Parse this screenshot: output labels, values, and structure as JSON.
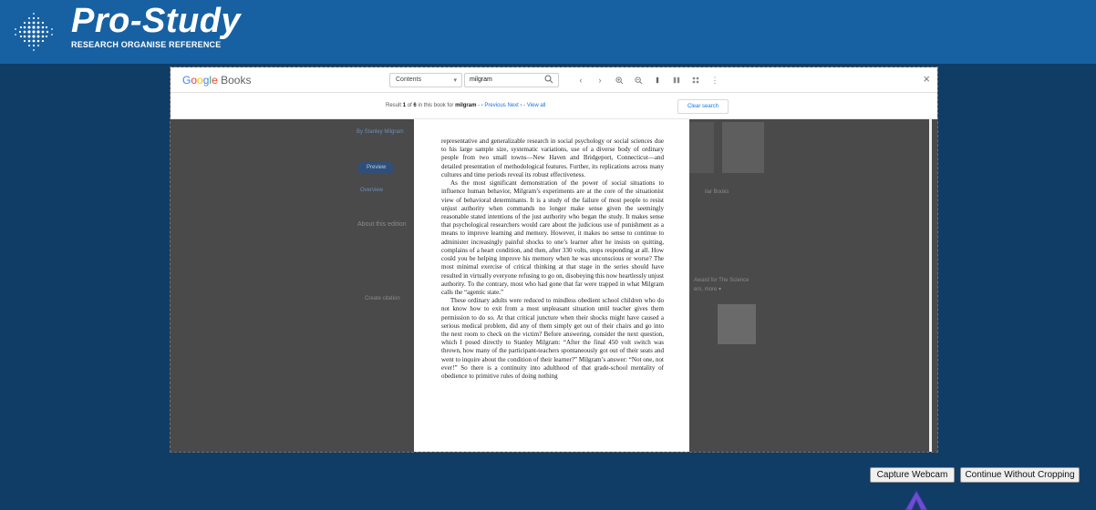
{
  "app": {
    "title": "Pro-Study",
    "subtitle": "RESEARCH ORGANISE REFERENCE"
  },
  "viewer": {
    "brand": {
      "google": [
        "G",
        "o",
        "o",
        "g",
        "l",
        "e"
      ],
      "books": "Books"
    },
    "toolbar": {
      "contents_label": "Contents",
      "search_value": "milgram",
      "close_label": "×"
    },
    "result": {
      "prefix": "Result ",
      "current": "1",
      "of": " of ",
      "total": "6",
      "in_book_for": " in this book for ",
      "term": "milgram",
      "previous": "‹ Previous",
      "next": "Next ›",
      "view_all": "View all",
      "clear_search": "Clear search"
    },
    "page_paragraphs": [
      "representative and generalizable research in social psychology or social sciences due to his large sample size, systematic variations, use of a diverse body of ordinary people from two small towns—New Haven and Bridgeport, Connecticut—and detailed presentation of methodological features. Further, its replications across many cultures and time periods reveal its robust effectiveness.",
      "As the most significant demonstration of the power of social situations to influence human behavior, Milgram’s experiments are at the core of the situationist view of behavioral determinants. It is a study of the failure of most people to resist unjust authority when commands no longer make sense given the seemingly reasonable stated intentions of the just authority who began the study. It makes sense that psychological researchers would care about the judicious use of punishment as a means to improve learning and memory. However, it makes no sense to continue to administer increasingly painful shocks to one’s learner after he insists on quitting, complains of a heart condition, and then, after 330 volts, stops responding at all. How could you be helping improve his memory when he was unconscious or worse? The most minimal exercise of critical thinking at that stage in the series should have resulted in virtually everyone refusing to go on, disobeying this now heartlessly unjust authority. To the contrary, most who had gone that far were trapped in what Milgram calls the “agentic state.”",
      "These ordinary adults were reduced to mindless obedient school children who do not know how to exit from a most unpleasant situation until teacher gives them permission to do so. At that critical juncture when their shocks might have caused a serious medical problem, did any of them simply get out of their chairs and go into the next room to check on the victim? Before answering, consider the next question, which I posed directly to Stanley Milgram: “After the final 450 volt switch was thrown, how many of the participant-teachers spontaneously got out of their seats and went to inquire about the condition of their learner?” Milgram’s answer: “Not one, not ever!” So there is a continuity into adulthood of that grade-school mentality of obedience to primitive rules of doing nothing"
    ],
    "background": {
      "byline": "By Stanley Milgram",
      "preview_chip": "Preview",
      "tab_overview": "Overview",
      "about": "About this edition",
      "create_citation": "Create citation",
      "similar": "ilar Books",
      "reader_link": "Award for The Science",
      "more": "ers, more ▾"
    }
  },
  "actions": {
    "capture_webcam": "Capture Webcam",
    "continue_without_cropping": "Continue Without Cropping"
  },
  "colors": {
    "header": "#1761a3",
    "background": "#0f3d66",
    "accent_cursor": "#6a4fd1"
  }
}
